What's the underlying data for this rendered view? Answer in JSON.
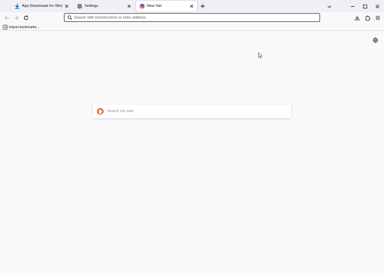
{
  "tabs": [
    {
      "title": "App Downloads for Windows",
      "icon": "download-arrow-icon",
      "active": false
    },
    {
      "title": "Settings",
      "icon": "gear-icon",
      "active": false
    },
    {
      "title": "New Tab",
      "icon": "firefox-icon",
      "active": true
    }
  ],
  "urlbar": {
    "placeholder": "Search with DuckDuckGo or enter address",
    "value": ""
  },
  "bookmarks": {
    "import_label": "Import bookmarks..."
  },
  "newtab": {
    "search_placeholder": "Search the web"
  },
  "colors": {
    "accent_download": "#0060df",
    "ddg_orange": "#de5833",
    "page_bg": "#f9f9fb",
    "tabstrip_bg": "#f0f0f4"
  }
}
